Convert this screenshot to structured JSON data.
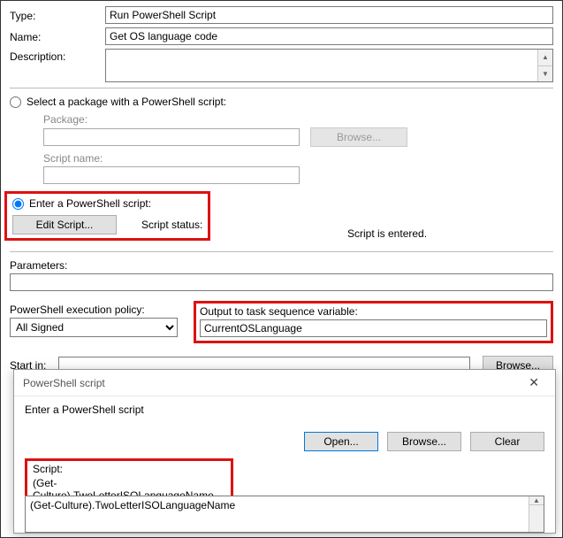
{
  "header": {
    "type_label": "Type:",
    "type_value": "Run PowerShell Script",
    "name_label": "Name:",
    "name_value": "Get OS language code",
    "description_label": "Description:",
    "description_value": ""
  },
  "package_section": {
    "radio_label": "Select a package with a PowerShell script:",
    "package_label": "Package:",
    "browse_label": "Browse...",
    "script_name_label": "Script name:"
  },
  "enter_section": {
    "radio_label": "Enter a PowerShell script:",
    "edit_button": "Edit Script...",
    "status_label": "Script status:",
    "status_value": "Script is entered."
  },
  "parameters": {
    "label": "Parameters:",
    "value": ""
  },
  "execution_policy": {
    "label": "PowerShell execution policy:",
    "value": "All Signed"
  },
  "output_var": {
    "label": "Output to task sequence variable:",
    "value": "CurrentOSLanguage"
  },
  "start_in": {
    "label": "Start in:",
    "value": "",
    "browse_label": "Browse..."
  },
  "dialog": {
    "title": "PowerShell script",
    "instruction": "Enter a PowerShell script",
    "open_label": "Open...",
    "browse_label": "Browse...",
    "clear_label": "Clear",
    "script_label": "Script:",
    "script_value": "(Get-Culture).TwoLetterISOLanguageName"
  }
}
